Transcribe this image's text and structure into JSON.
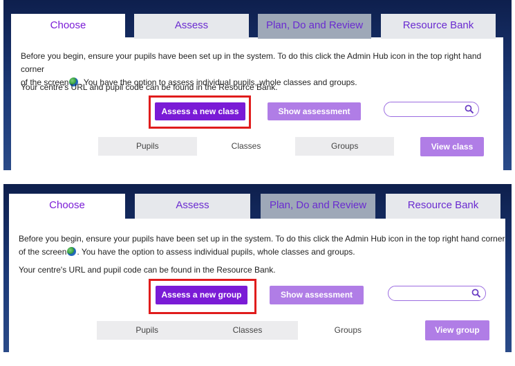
{
  "panels": [
    {
      "tabs": [
        "Choose",
        "Assess",
        "Plan, Do and Review",
        "Resource Bank"
      ],
      "intro_line1": "Before you begin, ensure your pupils have been set up in the system. To do this click the Admin Hub icon in the top right hand corner",
      "intro_line2_pre": "of the screen",
      "intro_line2_post": ". You have the option to assess individual pupils, whole classes and groups.",
      "url_note": "Your centre's URL and pupil code can be found in the Resource Bank.",
      "new_button": "Assess a new class",
      "show_button": "Show assessment",
      "search_placeholder": "",
      "segments": [
        "Pupils",
        "Classes",
        "Groups"
      ],
      "selected_segment": "Classes",
      "view_button": "View class"
    },
    {
      "tabs": [
        "Choose",
        "Assess",
        "Plan, Do and Review",
        "Resource Bank"
      ],
      "intro_line1": "Before you begin, ensure your pupils have been set up in the system. To do this click the Admin Hub icon in the top right hand corner",
      "intro_line2_pre": "of the screen",
      "intro_line2_post": ". You have the option to assess individual pupils, whole classes and groups.",
      "url_note": "Your centre's URL and pupil code can be found in the Resource Bank.",
      "new_button": "Assess a new group",
      "show_button": "Show assessment",
      "search_placeholder": "",
      "segments": [
        "Pupils",
        "Classes",
        "Groups"
      ],
      "selected_segment": "Groups",
      "view_button": "View group"
    }
  ],
  "colors": {
    "accent": "#7a1bd6",
    "accent_light": "#b07de6",
    "highlight": "#e01c1c",
    "navy": "#1c3a78"
  }
}
